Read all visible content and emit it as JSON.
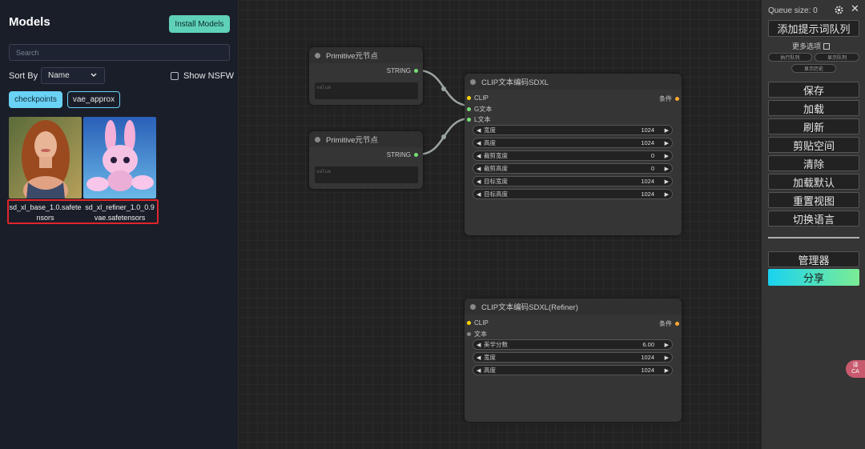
{
  "models_panel": {
    "title": "Models",
    "install_label": "Install Models",
    "search_placeholder": "Search",
    "sort_label": "Sort By",
    "sort_value": "Name",
    "nsfw_label": "Show NSFW",
    "tags": [
      "checkpoints",
      "vae_approx"
    ],
    "cards": [
      {
        "name": "sd_xl_base_1.0.safetensors"
      },
      {
        "name": "sd_xl_refiner_1.0_0.9vae.safetensors"
      }
    ]
  },
  "nodes": {
    "primitive1": {
      "title": "Primitive元节点",
      "output": "STRING",
      "text_placeholder": "value"
    },
    "primitive2": {
      "title": "Primitive元节点",
      "output": "STRING",
      "text_placeholder": "value"
    },
    "sdxl": {
      "title": "CLIP文本编码SDXL",
      "inputs": [
        "CLIP",
        "G文本",
        "L文本"
      ],
      "output": "条件",
      "widgets": [
        {
          "label": "宽度",
          "value": "1024"
        },
        {
          "label": "高度",
          "value": "1024"
        },
        {
          "label": "裁剪宽度",
          "value": "0"
        },
        {
          "label": "裁剪高度",
          "value": "0"
        },
        {
          "label": "目标宽度",
          "value": "1024"
        },
        {
          "label": "目标高度",
          "value": "1024"
        }
      ]
    },
    "refiner": {
      "title": "CLIP文本编码SDXL(Refiner)",
      "inputs": [
        "CLIP",
        "文本"
      ],
      "output": "条件",
      "widgets": [
        {
          "label": "美学分数",
          "value": "6.00"
        },
        {
          "label": "宽度",
          "value": "1024"
        },
        {
          "label": "高度",
          "value": "1024"
        }
      ]
    }
  },
  "menu": {
    "queue_size": "Queue size: 0",
    "queue_prompt": "添加提示词队列",
    "more_options": "更多选项",
    "mini_buttons": [
      "执行队列",
      "显示队列",
      "显示历史"
    ],
    "buttons": [
      "保存",
      "加载",
      "刷新",
      "剪贴空间",
      "清除",
      "加载默认",
      "重置视图",
      "切换语言"
    ],
    "manager": "管理器",
    "share": "分享"
  },
  "translate_badge": "译\nCA",
  "colors": {
    "accent_install": "#5fd1b9",
    "accent_tag": "#6ad2f5",
    "highlight": "#e0252a",
    "slot_clip": "#ffd500",
    "slot_string": "#77dd77",
    "slot_cond": "#ffa931"
  }
}
